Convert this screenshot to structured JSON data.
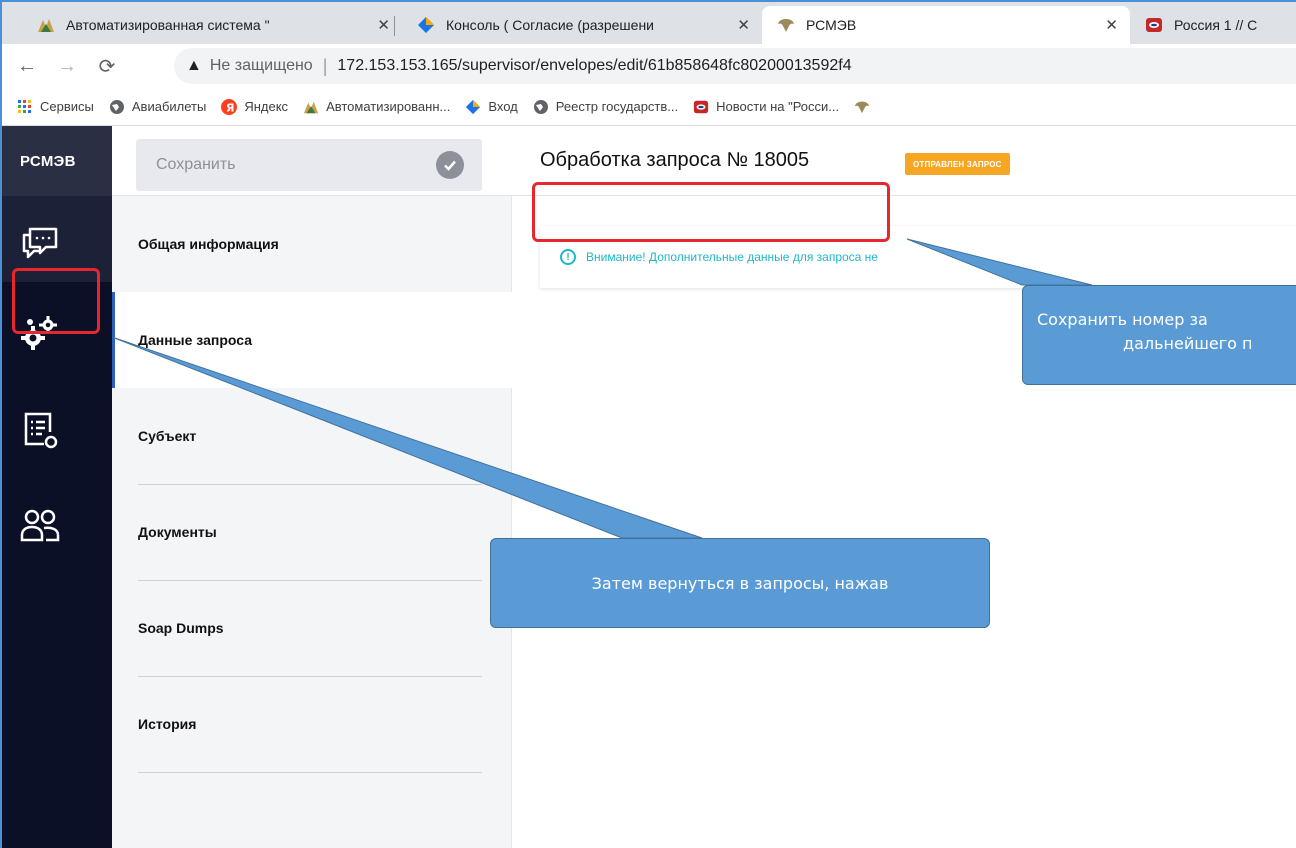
{
  "browser": {
    "tabs": [
      {
        "title": "Автоматизированная система \"",
        "close": "✕"
      },
      {
        "title": "Консоль ( Согласие (разрешени",
        "close": "✕"
      },
      {
        "title": "РСМЭВ",
        "close": "✕"
      },
      {
        "title": "Россия 1 // С",
        "close": ""
      }
    ],
    "address": {
      "not_secure": "Не защищено",
      "separator": "|",
      "url": "172.153.153.165/supervisor/envelopes/edit/61b858648fc80200013592f4"
    },
    "bookmarks": [
      {
        "label": "Сервисы",
        "icon": "apps-grid-icon"
      },
      {
        "label": "Авиабилеты",
        "icon": "globe-icon"
      },
      {
        "label": "Яндекс",
        "icon": "yandex-icon"
      },
      {
        "label": "Автоматизированн...",
        "icon": "site-favicon"
      },
      {
        "label": "Вход",
        "icon": "diamond-icon"
      },
      {
        "label": "Реестр государств...",
        "icon": "globe-icon"
      },
      {
        "label": "Новости на \"Росси...",
        "icon": "russia1-icon"
      }
    ]
  },
  "app": {
    "brand": "РСМЭВ",
    "save_label": "Сохранить",
    "page_title": "Обработка запроса № 18005",
    "status": "ОТПРАВЛЕН ЗАПРОС",
    "nav": [
      {
        "label": "Общая информация"
      },
      {
        "label": "Данные запроса"
      },
      {
        "label": "Субъект"
      },
      {
        "label": "Документы"
      },
      {
        "label": "Soap Dumps"
      },
      {
        "label": "История"
      }
    ],
    "alert_text": "Внимание! Дополнительные данные для запроса не",
    "colors": {
      "rail": "#0b1027",
      "badge": "#f5a623",
      "alert": "#1eb8c8",
      "callout": "#5b9bd5",
      "highlight": "#e8262d"
    }
  },
  "annotations": {
    "callout_top": "Сохранить номер за дальнейшего п",
    "callout_top_line1": "Сохранить номер за",
    "callout_top_line2": "дальнейшего п",
    "callout_bottom": "Затем вернуться в запросы, нажав"
  }
}
